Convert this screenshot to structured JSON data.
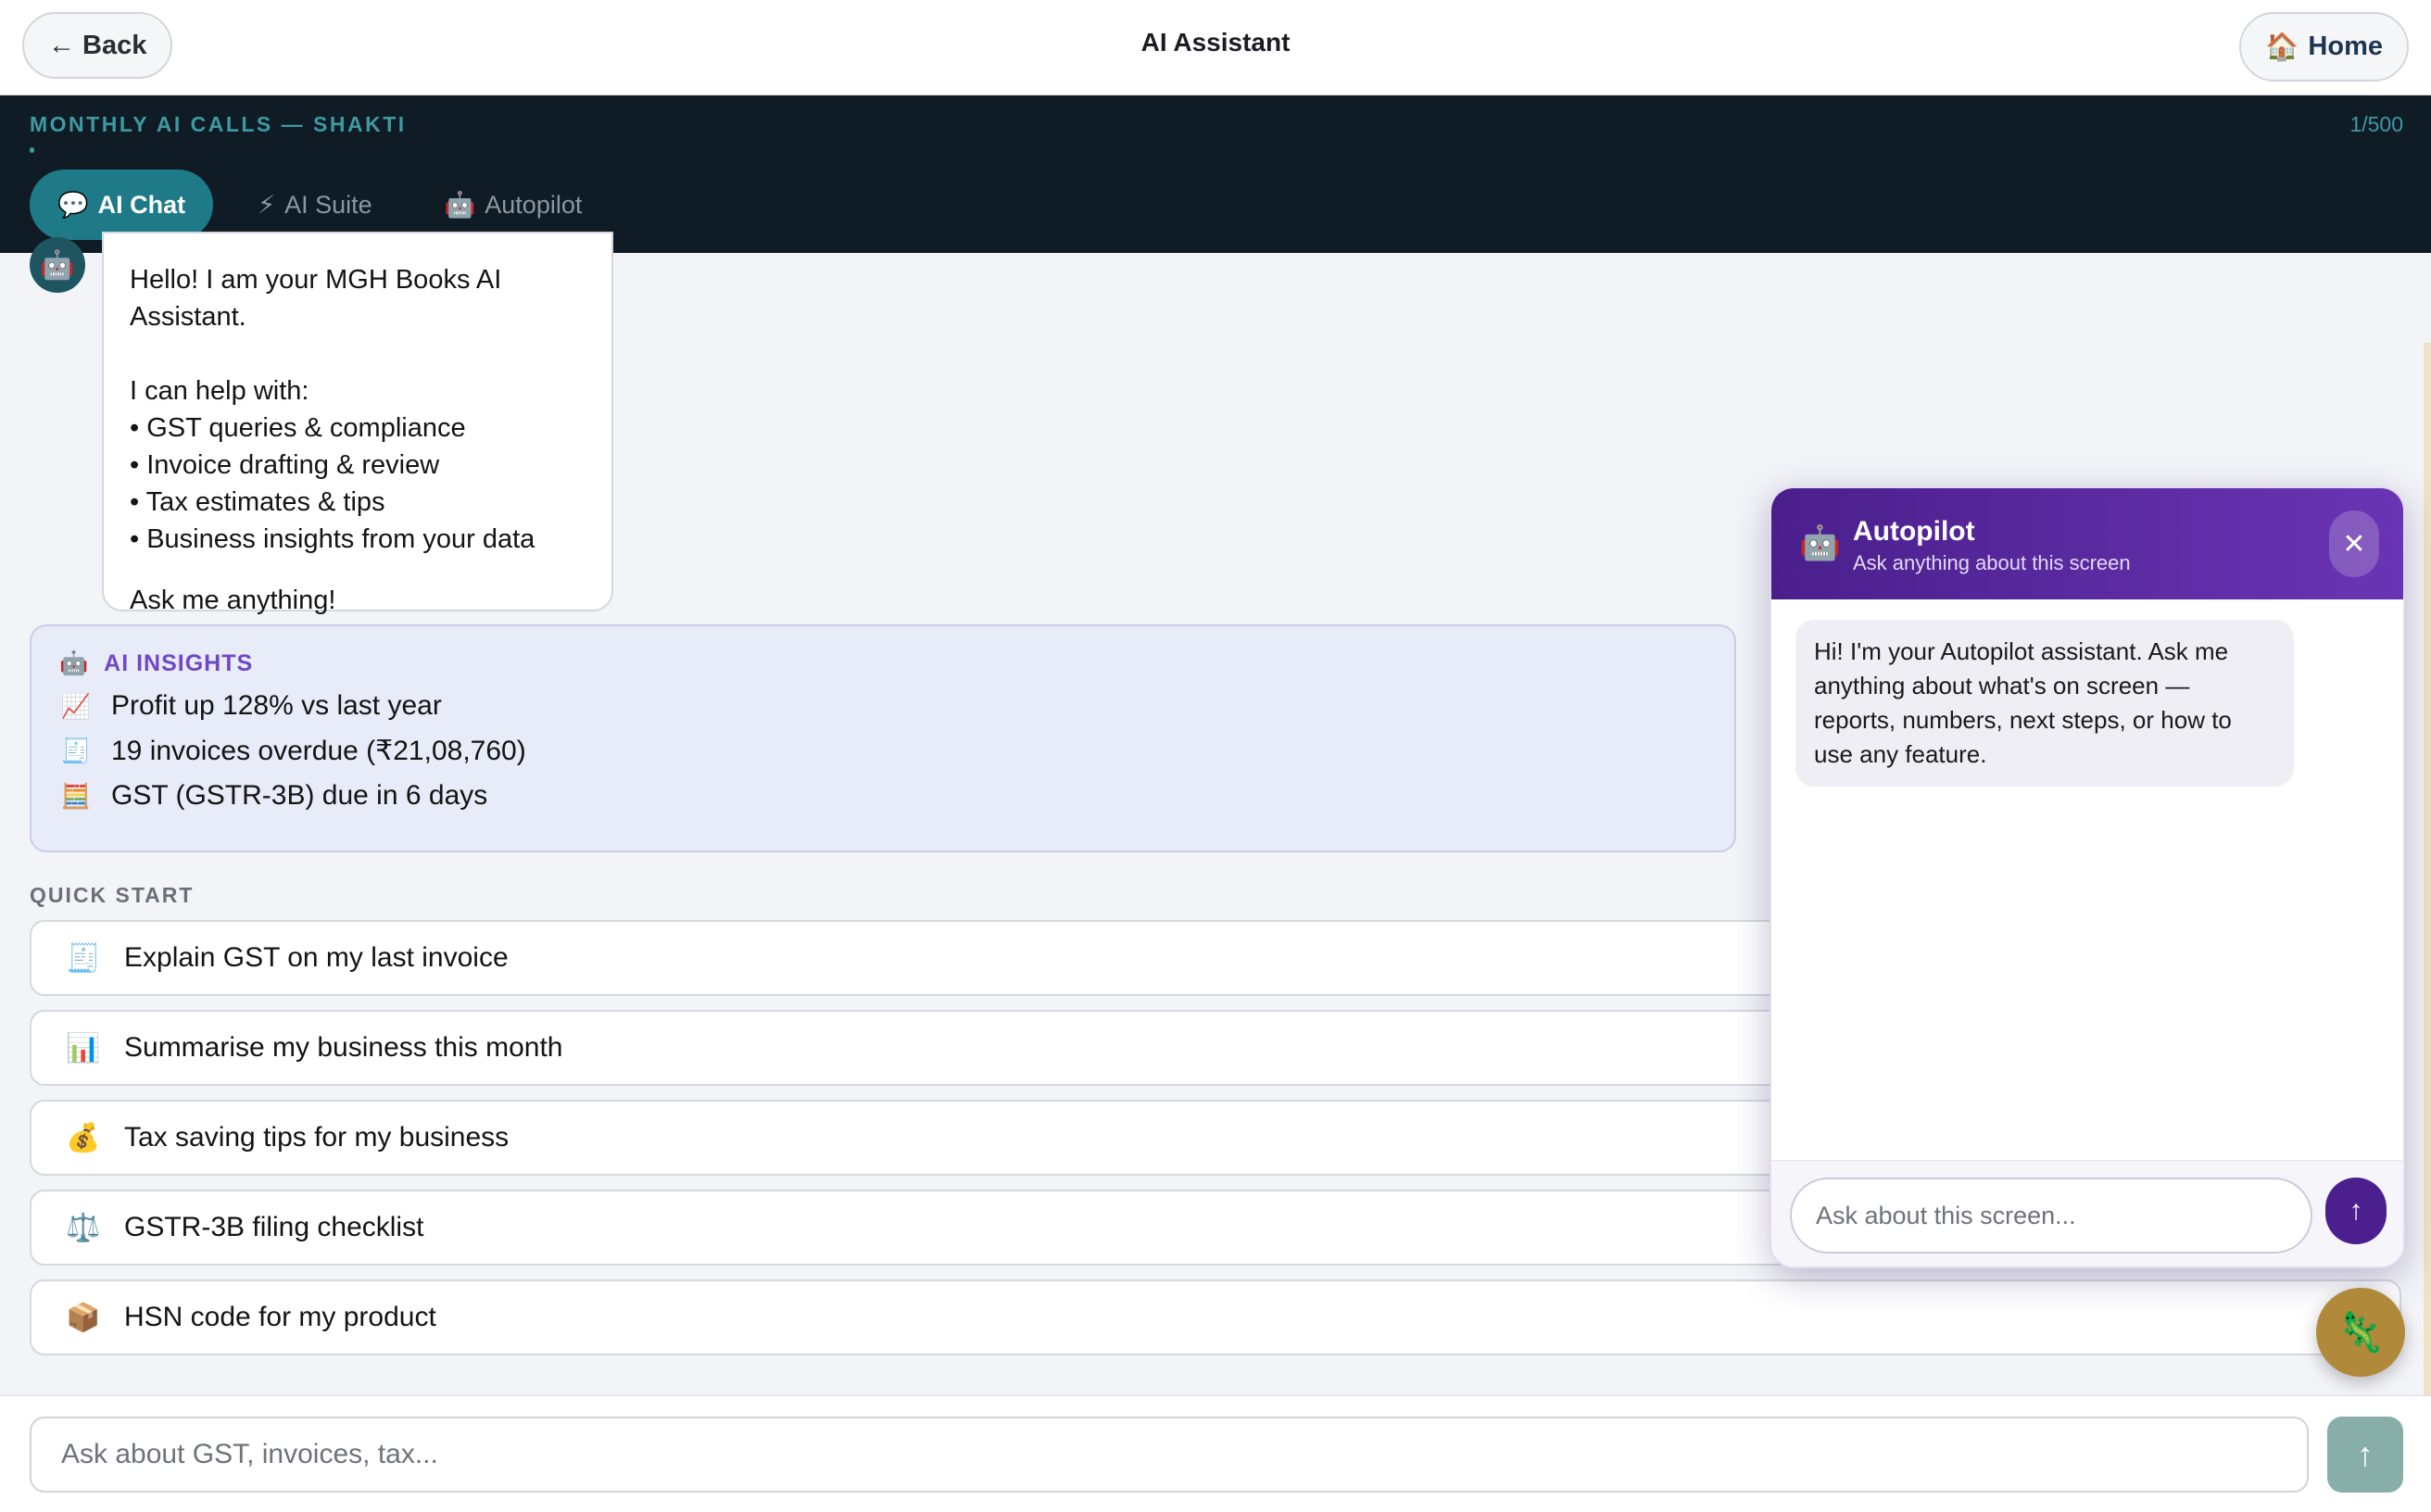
{
  "header": {
    "back_label": "Back",
    "back_arrow": "←",
    "title": "AI Assistant",
    "home_icon": "🏠",
    "home_label": "Home"
  },
  "usage": {
    "label": "MONTHLY AI CALLS — SHAKTI",
    "count": "1/500",
    "used": 1,
    "limit": 500,
    "color": "#3f9aa0"
  },
  "tabs": [
    {
      "icon": "💬",
      "label": "AI Chat",
      "active": true
    },
    {
      "icon": "⚡",
      "label": "AI Suite",
      "active": false
    },
    {
      "icon": "🤖",
      "label": "Autopilot",
      "active": false
    }
  ],
  "chat": {
    "bot_icon": "🤖",
    "greeting": {
      "intro": "Hello! I am your MGH Books AI Assistant.",
      "help_heading": "I can help with:",
      "items": [
        "• GST queries & compliance",
        "• Invoice drafting & review",
        "• Tax estimates & tips",
        "• Business insights from your data"
      ],
      "closing": "Ask me anything!"
    }
  },
  "insights": {
    "icon": "🤖",
    "heading": "AI INSIGHTS",
    "items": [
      {
        "icon": "📈",
        "text": "Profit up 128% vs last year"
      },
      {
        "icon": "🧾",
        "text": "19 invoices overdue (₹21,08,760)"
      },
      {
        "icon": "🧮",
        "text": "GST (GSTR-3B) due in 6 days"
      }
    ]
  },
  "quick_start": {
    "label": "QUICK START",
    "items": [
      {
        "icon": "🧾",
        "text": "Explain GST on my last invoice"
      },
      {
        "icon": "📊",
        "text": "Summarise my business this month"
      },
      {
        "icon": "💰",
        "text": "Tax saving tips for my business"
      },
      {
        "icon": "⚖️",
        "text": "GSTR-3B filing checklist"
      },
      {
        "icon": "📦",
        "text": "HSN code for my product"
      }
    ]
  },
  "composer": {
    "placeholder": "Ask about GST, invoices, tax...",
    "send_icon": "↑"
  },
  "autopilot": {
    "icon": "🤖",
    "title": "Autopilot",
    "subtitle": "Ask anything about this screen",
    "close_icon": "✕",
    "message": "Hi! I'm your Autopilot assistant. Ask me anything about what's on screen — reports, numbers, next steps, or how to use any feature.",
    "input_placeholder": "Ask about this screen...",
    "send_icon": "↑",
    "header_gradient": [
      "#4a1f8c",
      "#6a35b4"
    ]
  },
  "fab": {
    "icon": "🦎"
  }
}
